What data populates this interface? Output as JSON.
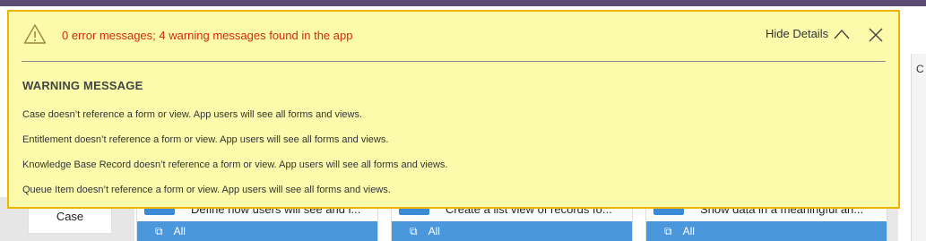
{
  "notification": {
    "summary": "0 error messages; 4 warning messages found in the app",
    "hide_details_label": "Hide Details",
    "section_title": "WARNING MESSAGE",
    "warnings": [
      "Case doesn’t reference a form or view. App users will see all forms and views.",
      "Entitlement doesn’t reference a form or view. App users will see all forms and views.",
      "Knowledge Base Record doesn’t reference a form or view. App users will see all forms and views.",
      "Queue Item doesn’t reference a form or view. App users will see all forms and views."
    ],
    "icons": {
      "warning": "warning-triangle-icon",
      "collapse": "chevron-up-icon",
      "close": "close-icon"
    },
    "colors": {
      "background": "#fbfbab",
      "border": "#f0b400",
      "summary_text": "#d42a0e"
    }
  },
  "background": {
    "entity_label": "Case",
    "cards": [
      {
        "description": "Define how users will see and i...",
        "filter_label": "All"
      },
      {
        "description": "Create a list view of records fo...",
        "filter_label": "All"
      },
      {
        "description": "Show data in a meaningful an...",
        "filter_label": "All"
      }
    ],
    "right_panel_letter": "C",
    "accent_color": "#4a97dc"
  }
}
